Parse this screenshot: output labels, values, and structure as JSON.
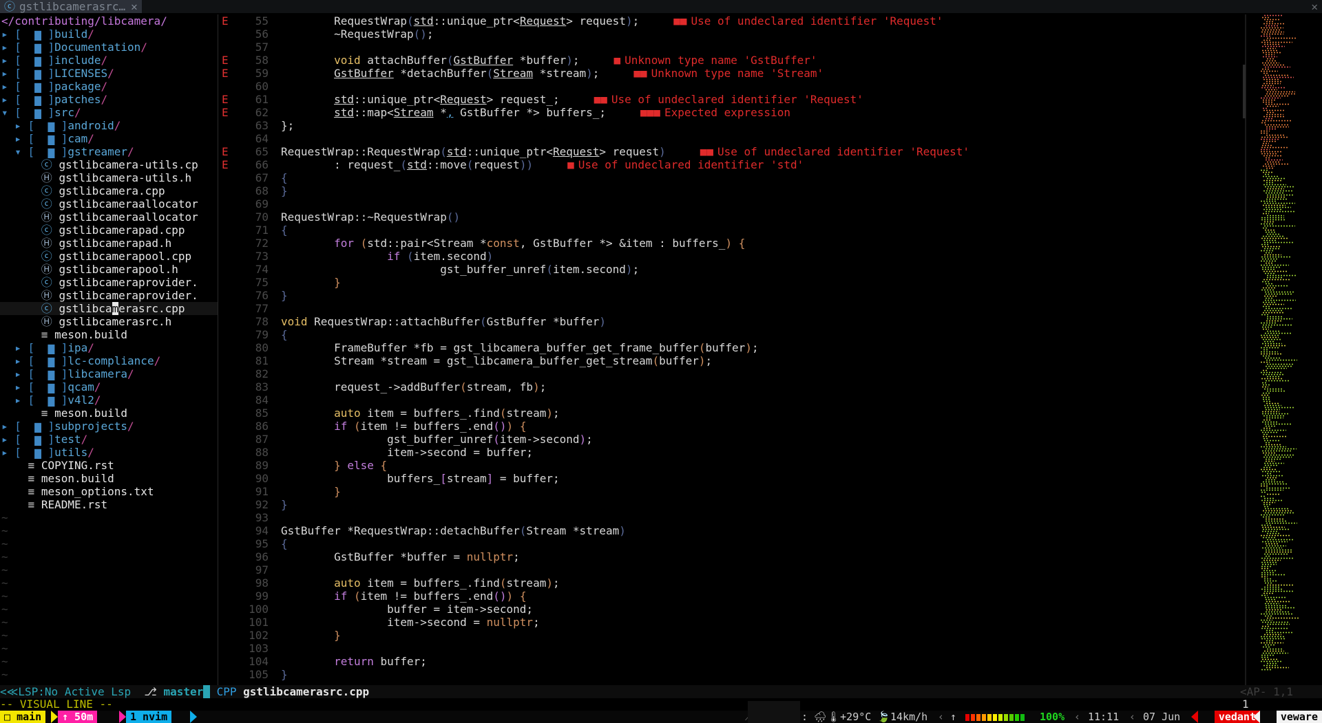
{
  "tab": {
    "title": "gstlibcamerasrc…",
    "close": "✕",
    "window_close": "✕"
  },
  "tree": {
    "root": "</contributing/libcamera/",
    "rows": [
      {
        "indent": 0,
        "tw": "▸",
        "type": "dir",
        "name": "build"
      },
      {
        "indent": 0,
        "tw": "▸",
        "type": "dir",
        "name": "Documentation"
      },
      {
        "indent": 0,
        "tw": "▸",
        "type": "dir",
        "name": "include"
      },
      {
        "indent": 0,
        "tw": "▸",
        "type": "dir",
        "name": "LICENSES"
      },
      {
        "indent": 0,
        "tw": "▸",
        "type": "dir",
        "name": "package"
      },
      {
        "indent": 0,
        "tw": "▸",
        "type": "dir",
        "name": "patches"
      },
      {
        "indent": 0,
        "tw": "▾",
        "type": "dir",
        "name": "src"
      },
      {
        "indent": 1,
        "tw": "▸",
        "type": "dir",
        "name": "android"
      },
      {
        "indent": 1,
        "tw": "▸",
        "type": "dir",
        "name": "cam"
      },
      {
        "indent": 1,
        "tw": "▾",
        "type": "dir",
        "name": "gstreamer"
      },
      {
        "indent": 2,
        "type": "c",
        "name": "gstlibcamera-utils.cp"
      },
      {
        "indent": 2,
        "type": "h",
        "name": "gstlibcamera-utils.h"
      },
      {
        "indent": 2,
        "type": "c",
        "name": "gstlibcamera.cpp"
      },
      {
        "indent": 2,
        "type": "c",
        "name": "gstlibcameraallocator"
      },
      {
        "indent": 2,
        "type": "h",
        "name": "gstlibcameraallocator"
      },
      {
        "indent": 2,
        "type": "c",
        "name": "gstlibcamerapad.cpp"
      },
      {
        "indent": 2,
        "type": "h",
        "name": "gstlibcamerapad.h"
      },
      {
        "indent": 2,
        "type": "c",
        "name": "gstlibcamerapool.cpp"
      },
      {
        "indent": 2,
        "type": "h",
        "name": "gstlibcamerapool.h"
      },
      {
        "indent": 2,
        "type": "c",
        "name": "gstlibcameraprovider."
      },
      {
        "indent": 2,
        "type": "h",
        "name": "gstlibcameraprovider."
      },
      {
        "indent": 2,
        "type": "c",
        "name": "gstlibcamerasrc.cpp",
        "current": true
      },
      {
        "indent": 2,
        "type": "h",
        "name": "gstlibcamerasrc.h"
      },
      {
        "indent": 2,
        "type": "m",
        "name": "meson.build"
      },
      {
        "indent": 1,
        "tw": "▸",
        "type": "dir",
        "name": "ipa"
      },
      {
        "indent": 1,
        "tw": "▸",
        "type": "dir",
        "name": "lc-compliance"
      },
      {
        "indent": 1,
        "tw": "▸",
        "type": "dir",
        "name": "libcamera"
      },
      {
        "indent": 1,
        "tw": "▸",
        "type": "dir",
        "name": "qcam"
      },
      {
        "indent": 1,
        "tw": "▸",
        "type": "dir",
        "name": "v4l2"
      },
      {
        "indent": 1,
        "type": "m",
        "name": "meson.build"
      },
      {
        "indent": 0,
        "tw": "▸",
        "type": "dir",
        "name": "subprojects"
      },
      {
        "indent": 0,
        "tw": "▸",
        "type": "dir",
        "name": "test"
      },
      {
        "indent": 0,
        "tw": "▸",
        "type": "dir",
        "name": "utils"
      },
      {
        "indent": 0,
        "type": "m",
        "name": "COPYING.rst"
      },
      {
        "indent": 0,
        "type": "m",
        "name": "meson.build"
      },
      {
        "indent": 0,
        "type": "m",
        "name": "meson_options.txt"
      },
      {
        "indent": 0,
        "type": "m",
        "name": "README.rst"
      }
    ],
    "tilde": "~"
  },
  "editor": {
    "lines": [
      {
        "n": "55",
        "e": true,
        "h": "\t<span class=\"code\">RequestWrap</span><span class=\"par\">(</span><span class=\"ul\">std</span>::unique_ptr&lt;<span class=\"ul\">Request</span>&gt; request<span class=\"par\">)</span>;",
        "d": "Use of undeclared identifier 'Request'",
        "b": "■■"
      },
      {
        "n": "56",
        "h": "\t~RequestWrap<span class=\"par\">()</span>;"
      },
      {
        "n": "57",
        "h": ""
      },
      {
        "n": "58",
        "e": true,
        "h": "\t<span class=\"type\">void</span> attachBuffer<span class=\"par\">(</span><span class=\"ul\">GstBuffer</span> *buffer<span class=\"par\">)</span>;",
        "d": "Unknown type name 'GstBuffer'",
        "b": "■"
      },
      {
        "n": "59",
        "e": true,
        "h": "\t<span class=\"ul\">GstBuffer</span> *detachBuffer<span class=\"par\">(</span><span class=\"ul\">Stream</span> *stream<span class=\"par\">)</span>;",
        "d": "Unknown type name 'Stream'",
        "b": "■■"
      },
      {
        "n": "60",
        "h": ""
      },
      {
        "n": "61",
        "e": true,
        "h": "\t<span class=\"ul\">std</span>::unique_ptr&lt;<span class=\"ul\">Request</span>&gt; request_;",
        "d": "Use of undeclared identifier 'Request'",
        "b": "■■"
      },
      {
        "n": "62",
        "e": true,
        "h": "\t<span class=\"ul\">std</span>::map&lt;<span class=\"ul\">Stream</span> *<span class=\"ul\" style=\"color:#5aa7d8\">,</span> GstBuffer *&gt; buffers_;",
        "d": "Expected expression",
        "b": "■■■"
      },
      {
        "n": "63",
        "h": "};"
      },
      {
        "n": "64",
        "h": ""
      },
      {
        "n": "65",
        "e": true,
        "h": "RequestWrap::RequestWrap<span class=\"par\">(</span><span class=\"ul\">std</span>::unique_ptr&lt;<span class=\"ul\">Request</span>&gt; request<span class=\"par\">)</span>",
        "d": "Use of undeclared identifier 'Request'",
        "b": "■■"
      },
      {
        "n": "66",
        "e": true,
        "h": "\t: request_<span class=\"par\">(</span><span class=\"ul\">std</span>::move<span class=\"par\">(</span>request<span class=\"par\">))</span>",
        "d": "Use of undeclared identifier 'std'",
        "b": "■"
      },
      {
        "n": "67",
        "h": "<span class=\"par\">{</span>"
      },
      {
        "n": "68",
        "h": "<span class=\"par\">}</span>"
      },
      {
        "n": "69",
        "h": ""
      },
      {
        "n": "70",
        "h": "RequestWrap::~RequestWrap<span class=\"par\">()</span>"
      },
      {
        "n": "71",
        "h": "<span class=\"par\">{</span>"
      },
      {
        "n": "72",
        "h": "\t<span class=\"kw\">for</span> <span class=\"num\">(</span>std::pair&lt;Stream *<span class=\"num\">const</span>, GstBuffer *&gt; &amp;item : buffers_<span class=\"num\">)</span> <span class=\"num\">{</span>"
      },
      {
        "n": "73",
        "h": "\t\t<span class=\"kw\">if</span> <span class=\"par\">(</span>item.second<span class=\"par\">)</span>"
      },
      {
        "n": "74",
        "h": "\t\t\tgst_buffer_unref<span class=\"par\">(</span>item.second<span class=\"par\">)</span>;"
      },
      {
        "n": "75",
        "h": "\t<span class=\"num\">}</span>"
      },
      {
        "n": "76",
        "h": "<span class=\"par\">}</span>"
      },
      {
        "n": "77",
        "h": ""
      },
      {
        "n": "78",
        "h": "<span class=\"type\">void</span> RequestWrap::attachBuffer<span class=\"par\">(</span>GstBuffer *buffer<span class=\"par\">)</span>"
      },
      {
        "n": "79",
        "h": "<span class=\"par\">{</span>"
      },
      {
        "n": "80",
        "h": "\tFrameBuffer *fb = gst_libcamera_buffer_get_frame_buffer<span class=\"num\">(</span>buffer<span class=\"num\">)</span>;"
      },
      {
        "n": "81",
        "h": "\tStream *stream = gst_libcamera_buffer_get_stream<span class=\"num\">(</span>buffer<span class=\"num\">)</span>;"
      },
      {
        "n": "82",
        "h": ""
      },
      {
        "n": "83",
        "h": "\trequest_-&gt;addBuffer<span class=\"num\">(</span>stream, fb<span class=\"num\">)</span>;"
      },
      {
        "n": "84",
        "h": ""
      },
      {
        "n": "85",
        "h": "\t<span class=\"type\">auto</span> item = buffers_.find<span class=\"num\">(</span>stream<span class=\"num\">)</span>;"
      },
      {
        "n": "86",
        "h": "\t<span class=\"kw\">if</span> <span class=\"num\">(</span>item != buffers_.end<span class=\"kw\">()</span><span class=\"num\">)</span> <span class=\"num\">{</span>"
      },
      {
        "n": "87",
        "h": "\t\tgst_buffer_unref<span class=\"kw\">(</span>item-&gt;second<span class=\"kw\">)</span>;"
      },
      {
        "n": "88",
        "h": "\t\titem-&gt;second = buffer;"
      },
      {
        "n": "89",
        "h": "\t<span class=\"num\">}</span> <span class=\"kw\">else</span> <span class=\"num\">{</span>"
      },
      {
        "n": "90",
        "h": "\t\tbuffers_<span class=\"kw\">[</span>stream<span class=\"kw\">]</span> = buffer;"
      },
      {
        "n": "91",
        "h": "\t<span class=\"num\">}</span>"
      },
      {
        "n": "92",
        "h": "<span class=\"par\">}</span>"
      },
      {
        "n": "93",
        "h": ""
      },
      {
        "n": "94",
        "h": "GstBuffer *RequestWrap::detachBuffer<span class=\"par\">(</span>Stream *stream<span class=\"par\">)</span>"
      },
      {
        "n": "95",
        "h": "<span class=\"par\">{</span>"
      },
      {
        "n": "96",
        "h": "\tGstBuffer *buffer = <span class=\"num\">nullptr</span>;"
      },
      {
        "n": "97",
        "h": ""
      },
      {
        "n": "98",
        "h": "\t<span class=\"type\">auto</span> item = buffers_.find<span class=\"num\">(</span>stream<span class=\"num\">)</span>;"
      },
      {
        "n": "99",
        "h": "\t<span class=\"kw\">if</span> <span class=\"num\">(</span>item != buffers_.end<span class=\"kw\">()</span><span class=\"num\">)</span> <span class=\"num\">{</span>"
      },
      {
        "n": "100",
        "h": "\t\tbuffer = item-&gt;second;"
      },
      {
        "n": "101",
        "h": "\t\titem-&gt;second = <span class=\"num\">nullptr</span>;"
      },
      {
        "n": "102",
        "h": "\t<span class=\"num\">}</span>"
      },
      {
        "n": "103",
        "h": ""
      },
      {
        "n": "104",
        "h": "\t<span class=\"kw\">return</span> buffer;"
      },
      {
        "n": "105",
        "h": "<span class=\"par\">}</span>"
      }
    ]
  },
  "statusline": {
    "lsp": "<≪LSP:No Active Lsp",
    "branch_icon": "⎇",
    "branch": "master",
    "filetype": "CPP",
    "filename": "gstlibcamerasrc.cpp",
    "position": "<AP- 1,1"
  },
  "cmdline": {
    "mode": "-- VISUAL LINE --",
    "count": "1"
  },
  "tmux": {
    "session": "main",
    "uptime": "↑ 50m",
    "window": "1 nvim",
    "weather": ": 🌧🌡+29°C 🍃14km/h",
    "arrow": "↑",
    "battery": "100%",
    "time": "11:11",
    "date": "07 Jun",
    "user": "vedant",
    "host": "veware",
    "colors": {
      "session": "#f3e600",
      "uptime": "#ff1fa5",
      "window": "#0faeea",
      "user": "#e60000"
    }
  }
}
